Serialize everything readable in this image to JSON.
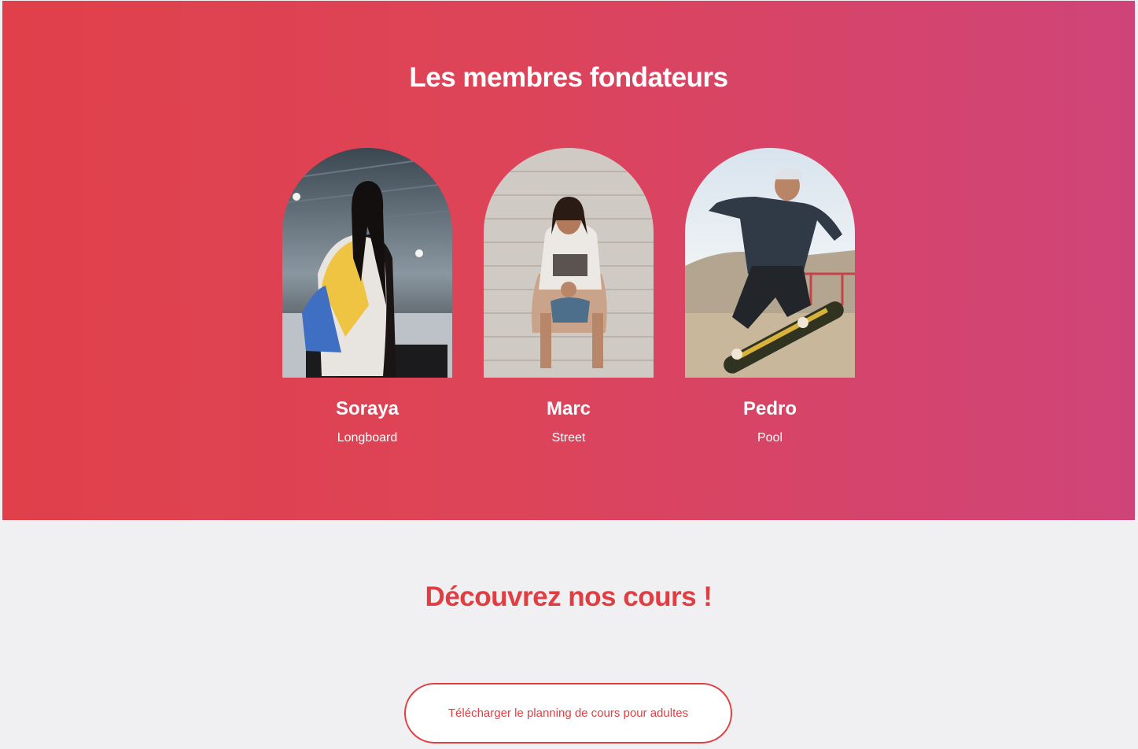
{
  "founders": {
    "title": "Les membres fondateurs",
    "members": [
      {
        "name": "Soraya",
        "style": "Longboard",
        "photo": "soraya-photo"
      },
      {
        "name": "Marc",
        "style": "Street",
        "photo": "marc-photo"
      },
      {
        "name": "Pedro",
        "style": "Pool",
        "photo": "pedro-photo"
      }
    ]
  },
  "courses": {
    "title": "Découvrez nos cours !",
    "download_label": "Télécharger le planning de cours pour adultes"
  },
  "colors": {
    "hero_gradient_start": "#e0404a",
    "hero_gradient_end": "#cf4478",
    "accent": "#df3f43",
    "page_background": "#f0eff1",
    "text_on_hero": "#ffffff"
  }
}
